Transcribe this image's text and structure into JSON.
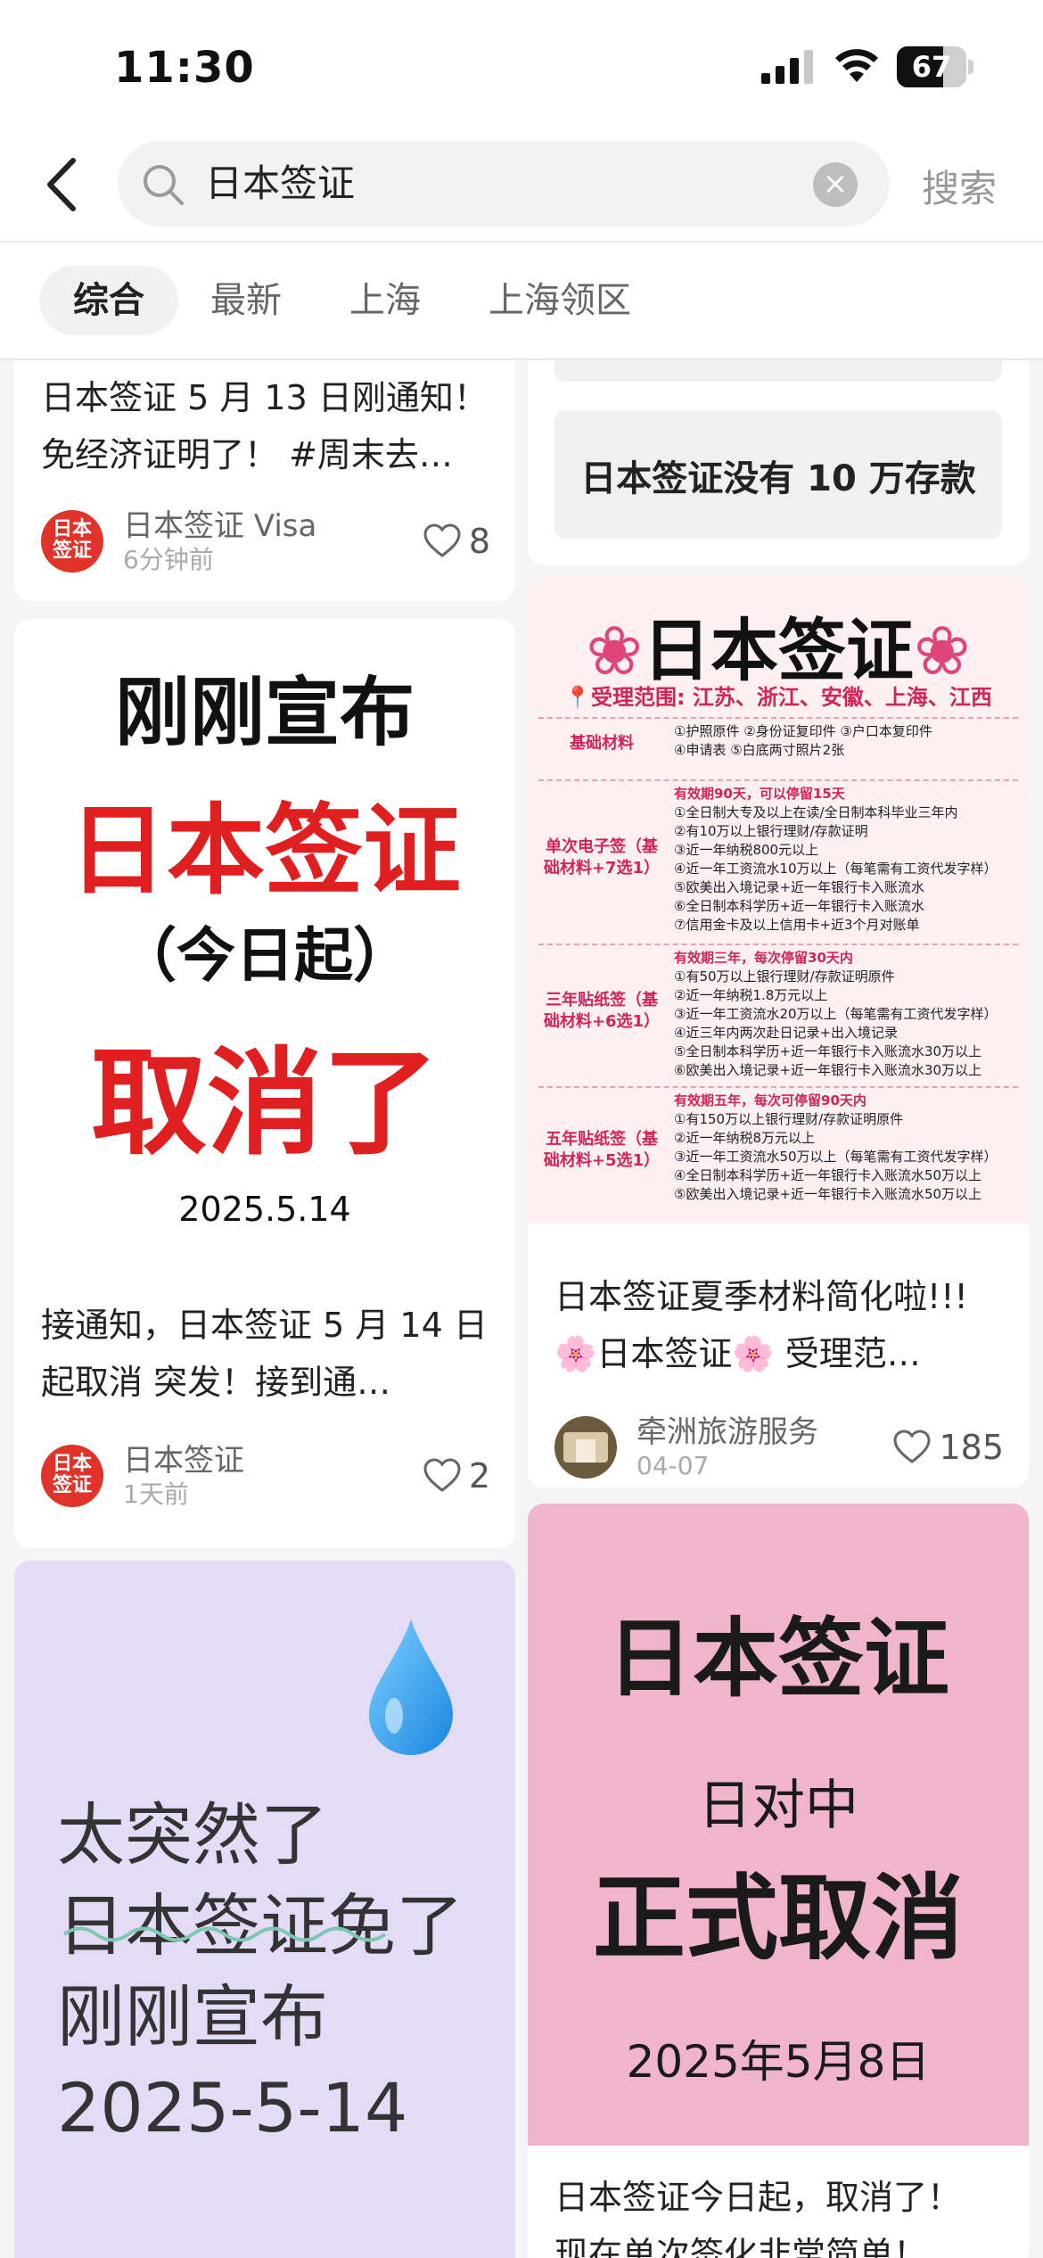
{
  "status_bar": {
    "time": "11:30",
    "battery": "67",
    "battery_level": 0.67
  },
  "search": {
    "query": "日本签证",
    "button_label": "搜索"
  },
  "tabs": [
    {
      "label": "综合",
      "active": true
    },
    {
      "label": "最新"
    },
    {
      "label": "上海"
    },
    {
      "label": "上海领区"
    }
  ],
  "colors": {
    "accent_red": "#e02020",
    "pink_cover": "#f0b4cc",
    "lavender_cover": "#e4dcf7"
  },
  "left_column": [
    {
      "title_line1": "日本签证 5 月 13 日刚通知！",
      "title_line2": "免经济证明了！ #周末去…",
      "author": "日本签证 Visa",
      "ago": "6分钟前",
      "likes": "8",
      "avatar_text": "日本签证"
    },
    {
      "cover": {
        "line1": "刚刚宣布",
        "line2": "日本签证",
        "line3": "（今日起）",
        "line4": "取消了",
        "date": "2025.5.14"
      },
      "title_line1": "接通知，日本签证 5 月 14 日",
      "title_line2": "起取消 突发！接到通…",
      "author": "日本签证",
      "ago": "1天前",
      "likes": "2",
      "avatar_text": "日本签证"
    },
    {
      "cover": {
        "line1": "太突然了",
        "line2": "日本签证免了",
        "line3": "刚刚宣布",
        "line4": "2025-5-14",
        "icon": "water-drop-icon"
      }
    }
  ],
  "right_column": [
    {
      "title": "日本签证没有 10 万存款"
    },
    {
      "cover": {
        "heading": "日本签证",
        "scope": "受理范围: 江苏、浙江、安徽、上海、江西",
        "rows": [
          {
            "label": "基础材料",
            "lines": [
              "①护照原件    ②身份证复印件    ③户口本复印件",
              "④申请表    ⑤白底两寸照片2张"
            ]
          },
          {
            "label": "单次电子签（基础材料+7选1）",
            "lines": [
              "有效期90天，可以停留15天",
              "①全日制大专及以上在读/全日制本科毕业三年内",
              "②有10万以上银行理财/存款证明",
              "③近一年纳税800元以上",
              "④近一年工资流水10万以上（每笔需有工资代发字样）",
              "⑤欧美出入境记录+近一年银行卡入账流水",
              "⑥全日制本科学历+近一年银行卡入账流水",
              "⑦信用金卡及以上信用卡+近3个月对账单"
            ]
          },
          {
            "label": "三年贴纸签（基础材料+6选1）",
            "lines": [
              "有效期三年，每次停留30天内",
              "①有50万以上银行理财/存款证明原件",
              "②近一年纳税1.8万元以上",
              "③近一年工资流水20万以上（每笔需有工资代发字样）",
              "④近三年内两次赴日记录+出入境记录",
              "⑤全日制本科学历+近一年银行卡入账流水30万以上",
              "⑥欧美出入境记录+近一年银行卡入账流水30万以上"
            ]
          },
          {
            "label": "五年贴纸签（基础材料+5选1）",
            "lines": [
              "有效期五年，每次可停留90天内",
              "①有150万以上银行理财/存款证明原件",
              "②近一年纳税8万元以上",
              "③近一年工资流水50万以上（每笔需有工资代发字样）",
              "④全日制本科学历+近一年银行卡入账流水50万以上",
              "⑤欧美出入境记录+近一年银行卡入账流水50万以上"
            ]
          }
        ]
      },
      "title_line1": "日本签证夏季材料简化啦!!!",
      "title_line2": "🌸日本签证🌸 受理范…",
      "author": "牵洲旅游服务",
      "ago": "04-07",
      "likes": "185"
    },
    {
      "cover": {
        "line1": "日本签证",
        "line2": "日对中",
        "line3": "正式取消",
        "line4": "2025年5月8日"
      },
      "title_line1": "日本签证今日起，取消了！",
      "title_line2": "现在单次签化非常简单！"
    }
  ]
}
